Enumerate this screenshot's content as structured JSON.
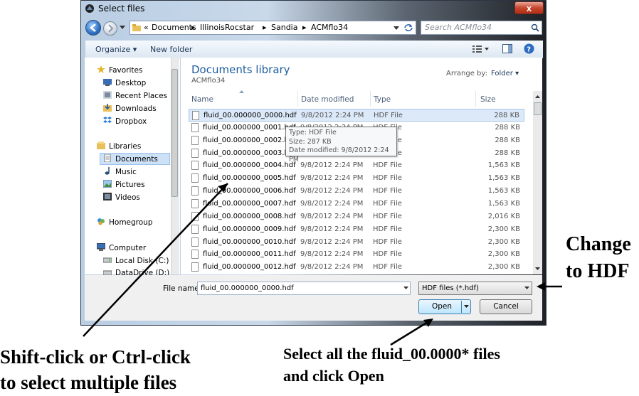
{
  "window": {
    "title": "Select files",
    "close_label": "x"
  },
  "address": {
    "prefix": "«",
    "crumbs": [
      "Documents",
      "IllinoisRocstar",
      "Sandia",
      "ACMflo34"
    ],
    "search_placeholder": "Search ACMflo34"
  },
  "toolbar": {
    "organize": "Organize ▾",
    "new_folder": "New folder"
  },
  "nav": {
    "favorites": "Favorites",
    "desktop": "Desktop",
    "recent": "Recent Places",
    "downloads": "Downloads",
    "dropbox": "Dropbox",
    "libraries": "Libraries",
    "documents": "Documents",
    "music": "Music",
    "pictures": "Pictures",
    "videos": "Videos",
    "homegroup": "Homegroup",
    "computer": "Computer",
    "localdisk": "Local Disk (C:)",
    "datadrive": "DataDrive (D:)"
  },
  "library": {
    "title": "Documents library",
    "subtitle": "ACMflo34",
    "arrange_label": "Arrange by:",
    "arrange_value": "Folder ▾"
  },
  "columns": {
    "name": "Name",
    "date": "Date modified",
    "type": "Type",
    "size": "Size"
  },
  "files": [
    {
      "name": "fluid_00.000000_0000.hdf",
      "date": "9/8/2012 2:24 PM",
      "type": "HDF File",
      "size": "288 KB"
    },
    {
      "name": "fluid_00.000000_0001.hdf",
      "date": "9/8/2012 2:24 PM",
      "type": "HDF File",
      "size": "288 KB"
    },
    {
      "name": "fluid_00.000000_0002.hdf",
      "date": "9/8/2012 2:24 PM",
      "type": "HDF File",
      "size": "288 KB"
    },
    {
      "name": "fluid_00.000000_0003.hdf",
      "date": "9/8/2012 2:24 PM",
      "type": "HDF File",
      "size": "288 KB"
    },
    {
      "name": "fluid_00.000000_0004.hdf",
      "date": "9/8/2012 2:24 PM",
      "type": "HDF File",
      "size": "1,563 KB"
    },
    {
      "name": "fluid_00.000000_0005.hdf",
      "date": "9/8/2012 2:24 PM",
      "type": "HDF File",
      "size": "1,563 KB"
    },
    {
      "name": "fluid_00.000000_0006.hdf",
      "date": "9/8/2012 2:24 PM",
      "type": "HDF File",
      "size": "1,563 KB"
    },
    {
      "name": "fluid_00.000000_0007.hdf",
      "date": "9/8/2012 2:24 PM",
      "type": "HDF File",
      "size": "1,563 KB"
    },
    {
      "name": "fluid_00.000000_0008.hdf",
      "date": "9/8/2012 2:24 PM",
      "type": "HDF File",
      "size": "2,016 KB"
    },
    {
      "name": "fluid_00.000000_0009.hdf",
      "date": "9/8/2012 2:24 PM",
      "type": "HDF File",
      "size": "2,300 KB"
    },
    {
      "name": "fluid_00.000000_0010.hdf",
      "date": "9/8/2012 2:24 PM",
      "type": "HDF File",
      "size": "2,300 KB"
    },
    {
      "name": "fluid_00.000000_0011.hdf",
      "date": "9/8/2012 2:24 PM",
      "type": "HDF File",
      "size": "2,300 KB"
    },
    {
      "name": "fluid_00.000000_0012.hdf",
      "date": "9/8/2012 2:24 PM",
      "type": "HDF File",
      "size": "2,300 KB"
    }
  ],
  "tooltip": {
    "line1": "Type: HDF File",
    "line2": "Size: 287 KB",
    "line3": "Date modified: 9/8/2012 2:24 PM"
  },
  "bottom": {
    "filename_label": "File name:",
    "filename_value": "fluid_00.000000_0000.hdf",
    "filter_value": "HDF files (*.hdf)",
    "open_label": "Open",
    "cancel_label": "Cancel"
  },
  "annotations": {
    "change_line1": "Change",
    "change_line2": "to HDF",
    "shift_line1": "Shift-click or Ctrl-click",
    "shift_line2": "to select multiple files",
    "select_line1": "Select all the fluid_00.0000* files",
    "select_line2": "and click Open"
  },
  "colors": {
    "accent": "#1e5d9e",
    "selection": "#dce9f9"
  }
}
